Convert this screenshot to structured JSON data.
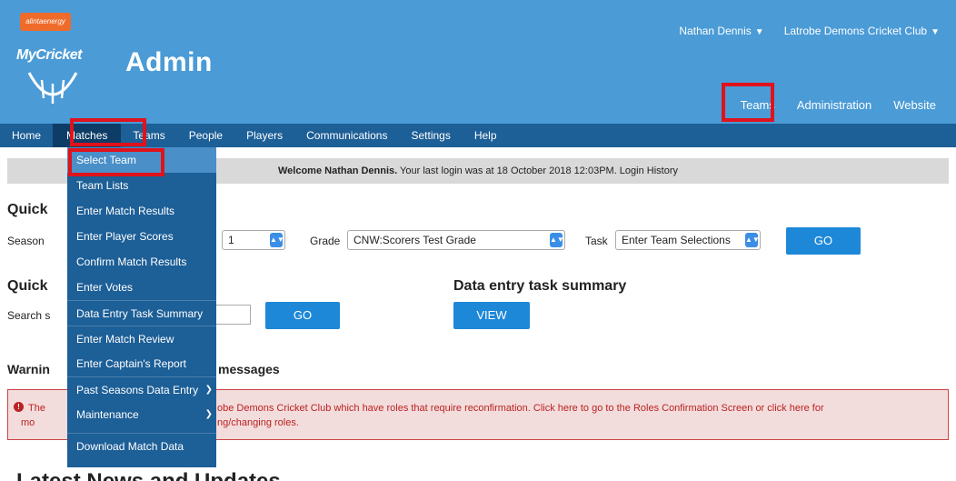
{
  "header": {
    "logo_badge": "alintaenergy",
    "logo_text": "MyCricket",
    "title": "Admin",
    "user_name": "Nathan Dennis",
    "club_name": "Latrobe Demons Cricket Club",
    "chevron": "❯"
  },
  "top_nav": [
    "Teams",
    "Administration",
    "Website"
  ],
  "main_nav": [
    "Home",
    "Matches",
    "Teams",
    "People",
    "Players",
    "Communications",
    "Settings",
    "Help"
  ],
  "welcome": {
    "bold": "Welcome Nathan Dennis.",
    "text": " Your last login was at 18 October 2018 12:03PM.  Login History"
  },
  "quick_entry": {
    "heading": "Quick",
    "season_label": "Season",
    "season_value": "1",
    "grade_label": "Grade",
    "grade_value": "CNW:Scorers Test Grade",
    "task_label": "Task",
    "task_value": "Enter Team Selections",
    "go_label": "GO"
  },
  "quick_search": {
    "heading": "Quick",
    "search_label": "Search s",
    "go_label": "GO"
  },
  "summary": {
    "heading": "Data entry task summary",
    "view_label": "VIEW"
  },
  "warning": {
    "heading_left": "Warnin",
    "heading_right": "messages",
    "line1_left": "The",
    "line1_right": "obe Demons Cricket Club which have roles that require reconfirmation.   Click here to go to the Roles Confirmation Screen or click here for",
    "line2_left": "mo",
    "line2_right": "ng/changing roles."
  },
  "latest_news": "Latest News and Updates",
  "dropdown": {
    "items": [
      "Select Team",
      "Team Lists",
      "Enter Match Results",
      "Enter Player Scores",
      "Confirm Match Results",
      "Enter Votes",
      "Data Entry Task Summary",
      "Enter Match Review",
      "Enter Captain's Report",
      "Past Seasons Data Entry",
      "Maintenance",
      "Download Match Data"
    ]
  },
  "colors": {
    "header_bg": "#4a9bd6",
    "navbar_bg": "#1d5f97",
    "highlight": "#e0121b",
    "button": "#1e88d8"
  }
}
